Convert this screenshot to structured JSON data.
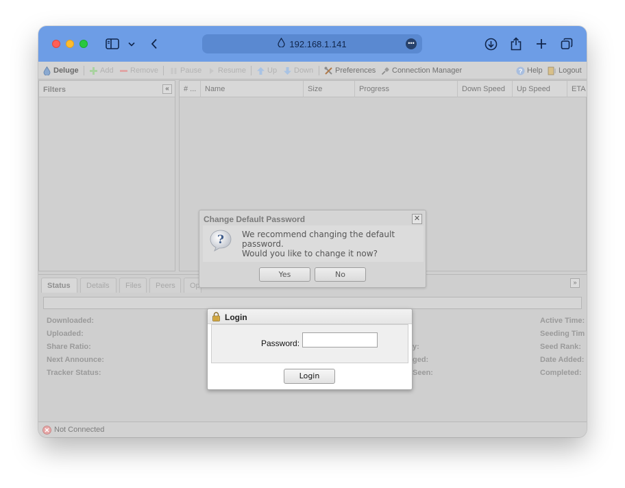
{
  "browser": {
    "url": "192.168.1.141"
  },
  "toolbar": {
    "deluge": "Deluge",
    "add": "Add",
    "remove": "Remove",
    "pause": "Pause",
    "resume": "Resume",
    "up": "Up",
    "down": "Down",
    "preferences": "Preferences",
    "connection_manager": "Connection Manager",
    "help": "Help",
    "logout": "Logout"
  },
  "filters": {
    "title": "Filters"
  },
  "torrent_grid": {
    "columns": [
      "# ...",
      "Name",
      "Size",
      "Progress",
      "Down Speed",
      "Up Speed",
      "ETA"
    ]
  },
  "details": {
    "tabs": [
      "Status",
      "Details",
      "Files",
      "Peers",
      "Opt"
    ],
    "left_stats": [
      "Downloaded:",
      "Uploaded:",
      "Share Ratio:",
      "Next Announce:",
      "Tracker Status:"
    ],
    "mid_stats": [
      "y:",
      "ged:",
      "Seen:"
    ],
    "right_stats": [
      "Active Time:",
      "Seeding Tim",
      "Seed Rank:",
      "Date Added:",
      "Completed:"
    ]
  },
  "statusbar": {
    "text": "Not Connected"
  },
  "password_dialog": {
    "title": "Change Default Password",
    "message1": "We recommend changing the default password.",
    "message2": "Would you like to change it now?",
    "yes": "Yes",
    "no": "No"
  },
  "login_dialog": {
    "title": "Login",
    "password_label": "Password:",
    "password_value": "",
    "button": "Login"
  }
}
